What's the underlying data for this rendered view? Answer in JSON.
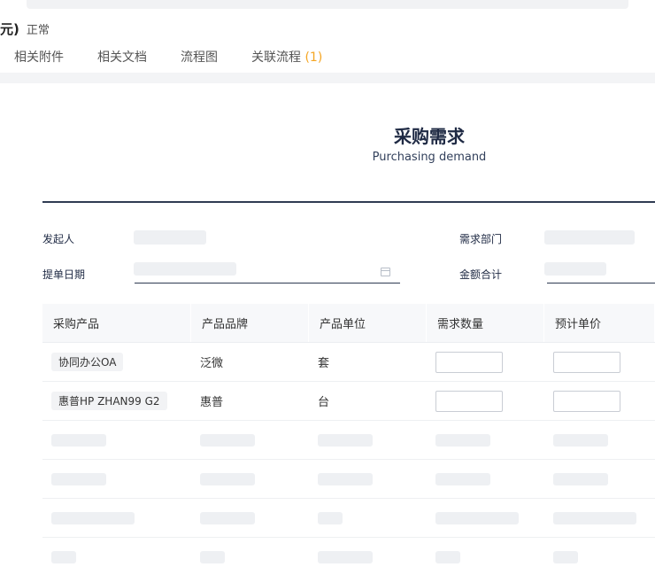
{
  "header": {
    "paren_text": "元)",
    "status_text": "正常"
  },
  "tabs": [
    {
      "label": "相关附件"
    },
    {
      "label": "相关文档"
    },
    {
      "label": "流程图"
    },
    {
      "label": "关联流程",
      "count": "(1)"
    }
  ],
  "form": {
    "title": "采购需求",
    "subtitle": "Purchasing demand",
    "fields": {
      "initiator_label": "发起人",
      "department_label": "需求部门",
      "date_label": "提单日期",
      "amount_label": "金额合计"
    }
  },
  "table": {
    "columns": [
      "采购产品",
      "产品品牌",
      "产品单位",
      "需求数量",
      "预计单价"
    ],
    "rows": [
      {
        "product": "协同办公OA",
        "brand": "泛微",
        "unit": "套",
        "quantity": "",
        "price": ""
      },
      {
        "product": "惠普HP ZHAN99 G2",
        "brand": "惠普",
        "unit": "台",
        "quantity": "",
        "price": ""
      }
    ]
  }
}
